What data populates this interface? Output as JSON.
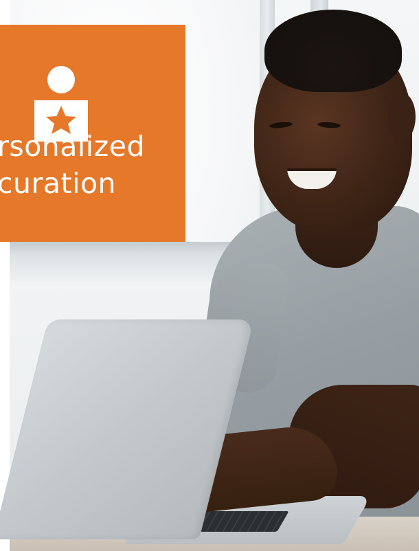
{
  "badge": {
    "line1": "rsonalized",
    "line2": "curation",
    "icon": "user-star-icon",
    "color": "#e6782a",
    "text_color": "#ffffff"
  },
  "photo": {
    "subject": "man-using-laptop",
    "shirt_color": "#969ea3"
  }
}
